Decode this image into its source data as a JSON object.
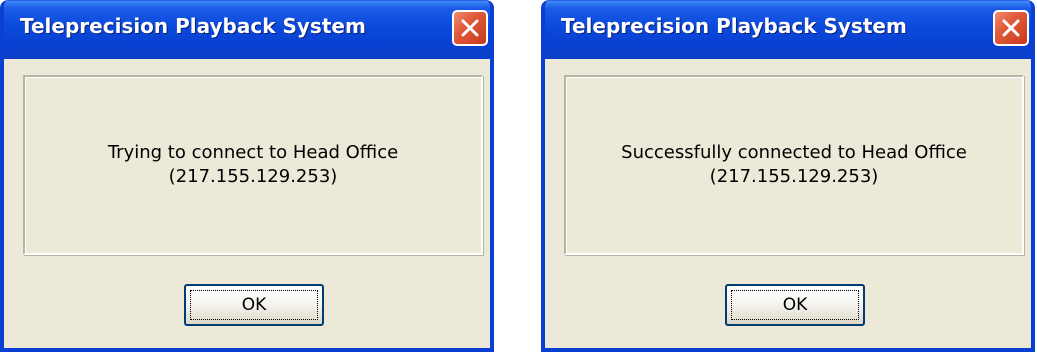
{
  "dialogs": [
    {
      "title": "Teleprecision Playback System",
      "message_line1": "Trying to connect to Head Office",
      "message_line2": "(217.155.129.253)",
      "ok_label": "OK",
      "close_icon": "close-icon"
    },
    {
      "title": "Teleprecision Playback System",
      "message_line1": "Successfully connected to Head Office",
      "message_line2": "(217.155.129.253)",
      "ok_label": "OK",
      "close_icon": "close-icon"
    }
  ],
  "colors": {
    "titlebar": "#0a49dc",
    "window_border": "#0a3fd4",
    "dialog_background": "#ece9d8",
    "close_button": "#e05a3a"
  }
}
